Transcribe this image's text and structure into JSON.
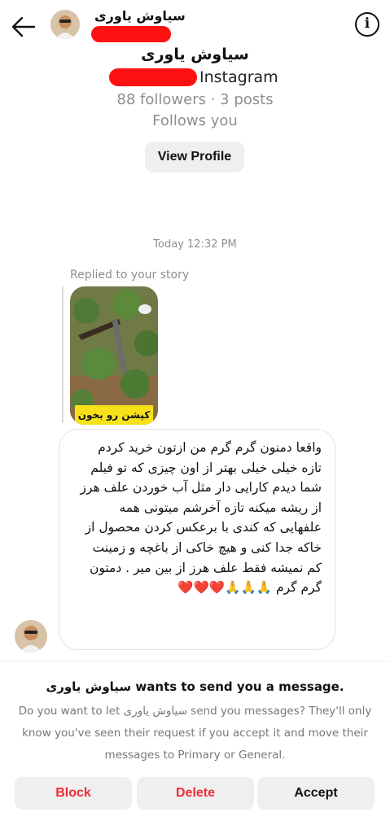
{
  "header": {
    "back_icon": "arrow-left-icon",
    "name": "سیاوش یاوری",
    "info_icon": "info-icon"
  },
  "profile": {
    "name": "سیاوش یاوری",
    "platform": "Instagram",
    "stats": "88 followers · 3 posts",
    "follows": "Follows you",
    "view_profile_label": "View Profile"
  },
  "thread": {
    "timestamp": "Today 12:32 PM",
    "replied_label": "Replied to your story",
    "story_caption": "کپشن رو بخون",
    "message_text": "واقعا دمنون گرم گرم من ازتون خرید کردم تازه خیلی خیلی بهتر از اون چیزی که تو فیلم شما دیدم کارایی دار مثل آب خوردن علف هرز از ریشه میکنه تازه آخرشم میتونی همه علفهایی که کندی با برعکس کردن محصول از خاکه جدا کنی و هیچ خاکی از باغچه و زمینت کم نمیشه فقط علف هرز از بین میر . دمتون  گرم گرم 🙏🙏🙏❤️❤️❤️"
  },
  "request": {
    "title": "سیاوش یاوری wants to send you a message.",
    "body": "Do you want to let سیاوش یاوری send you messages? They'll only know you've seen their request if you accept it and move their messages to Primary or General.",
    "buttons": {
      "block": "Block",
      "delete": "Delete",
      "accept": "Accept"
    }
  },
  "colors": {
    "danger": "#ed2e36",
    "secondary_text": "#8e8e8e",
    "redaction": "#ff1111"
  }
}
